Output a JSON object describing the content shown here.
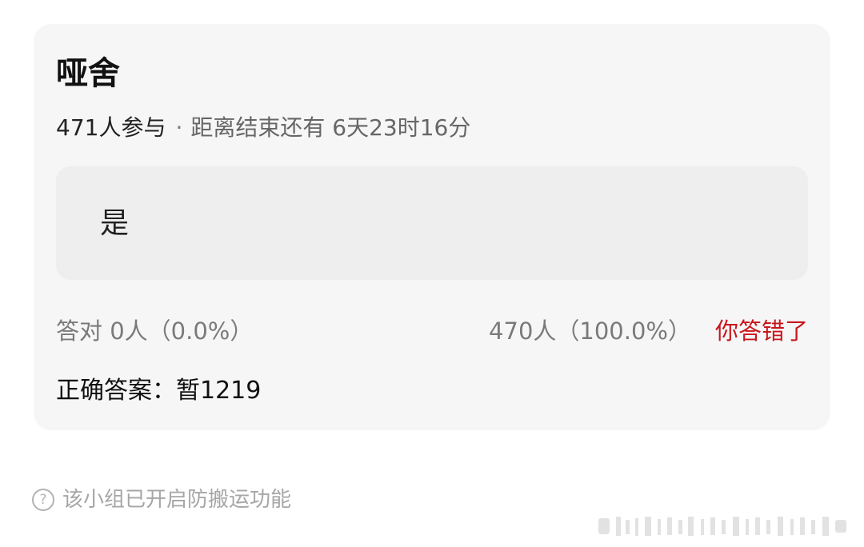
{
  "quiz": {
    "title": "哑舍",
    "participants": "471人参与",
    "separator": "·",
    "countdown": "距离结束还有 6天23时16分",
    "option": "是",
    "correct_stat": "答对  0人（0.0%）",
    "wrong_stat": "470人（100.0%）",
    "result_label": "你答错了",
    "answer_label": "正确答案：暂1219"
  },
  "footer": {
    "help_icon": "question-circle-icon",
    "help_glyph": "?",
    "notice": "该小组已开启防搬运功能"
  },
  "colors": {
    "card_bg": "#f6f6f6",
    "wrong_red": "#c8161d",
    "muted_text": "#7a7a7a"
  }
}
